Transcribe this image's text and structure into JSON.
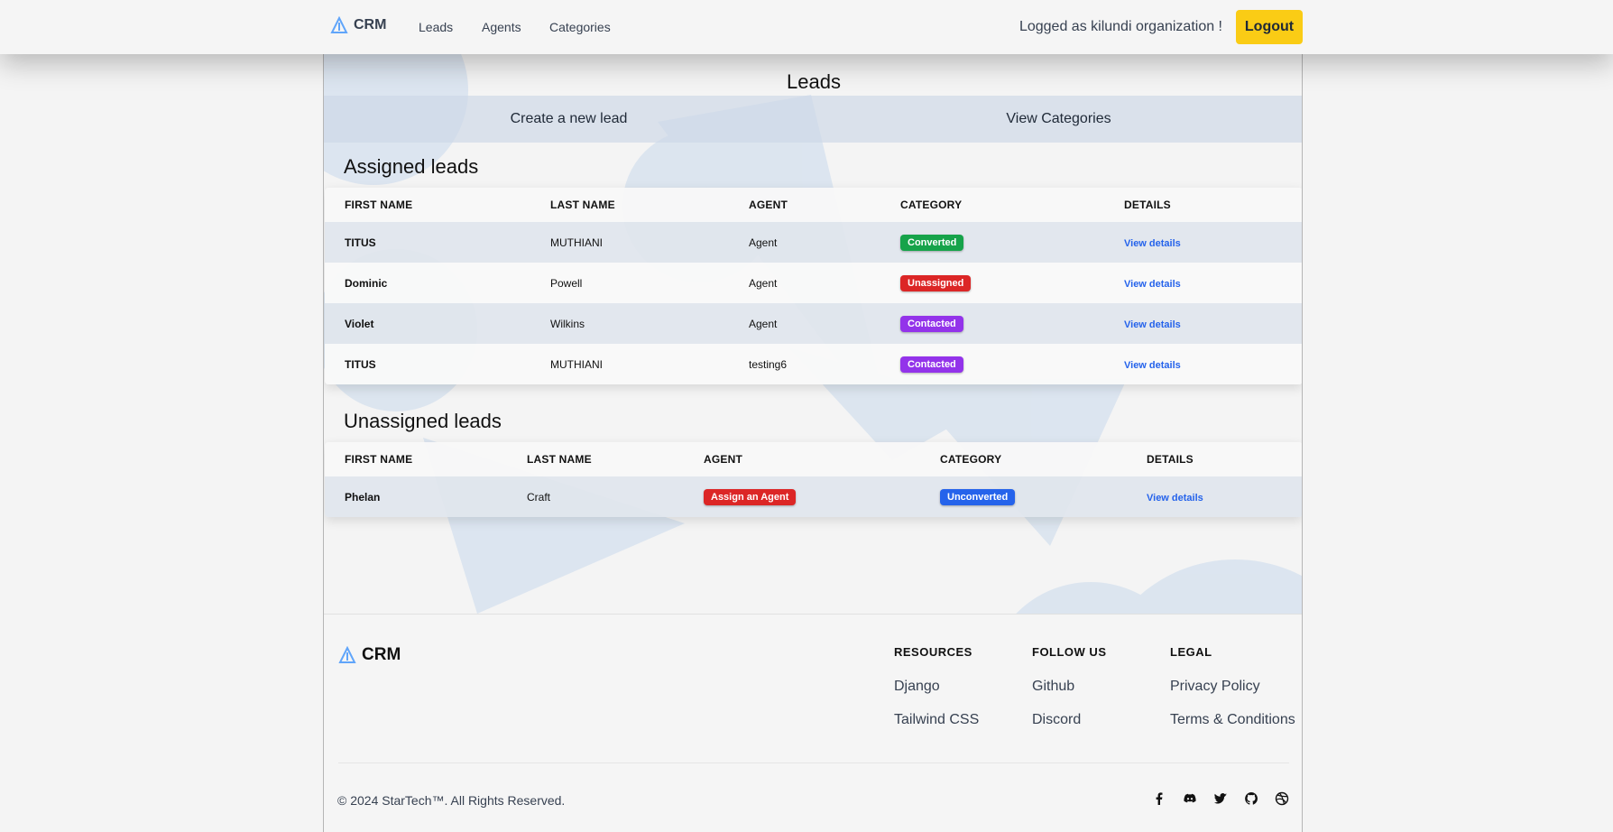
{
  "nav": {
    "brand": "CRM",
    "links": [
      "Leads",
      "Agents",
      "Categories"
    ],
    "user_text": "Logged as kilundi organization !",
    "logout_label": "Logout"
  },
  "main": {
    "title": "Leads",
    "actions": [
      "Create a new lead",
      "View Categories"
    ]
  },
  "assigned": {
    "title": "Assigned leads",
    "headers": [
      "FIRST NAME",
      "LAST NAME",
      "AGENT",
      "CATEGORY",
      "DETAILS"
    ],
    "rows": [
      {
        "first": "TITUS",
        "last": "MUTHIANI",
        "agent": "Agent",
        "category": "Converted",
        "details": "View details"
      },
      {
        "first": "Dominic",
        "last": "Powell",
        "agent": "Agent",
        "category": "Unassigned",
        "details": "View details"
      },
      {
        "first": "Violet",
        "last": "Wilkins",
        "agent": "Agent",
        "category": "Contacted",
        "details": "View details"
      },
      {
        "first": "TITUS",
        "last": "MUTHIANI",
        "agent": "testing6",
        "category": "Contacted",
        "details": "View details"
      }
    ]
  },
  "unassigned": {
    "title": "Unassigned leads",
    "headers": [
      "FIRST NAME",
      "LAST NAME",
      "AGENT",
      "CATEGORY",
      "DETAILS"
    ],
    "rows": [
      {
        "first": "Phelan",
        "last": "Craft",
        "agent": "Assign an Agent",
        "category": "Unconverted",
        "details": "View details"
      }
    ]
  },
  "category_colors": {
    "Converted": "#16a34a",
    "Unassigned": "#dc2626",
    "Contacted": "#9333ea",
    "Unconverted": "#2563eb",
    "Assign an Agent": "#dc2626"
  },
  "footer": {
    "brand": "CRM",
    "columns": [
      {
        "title": "RESOURCES",
        "links": [
          "Django",
          "Tailwind CSS"
        ]
      },
      {
        "title": "FOLLOW US",
        "links": [
          "Github",
          "Discord"
        ]
      },
      {
        "title": "LEGAL",
        "links": [
          "Privacy Policy",
          "Terms & Conditions"
        ]
      }
    ],
    "copyright": "© 2024 StarTech™. All Rights Reserved.",
    "socials": [
      "facebook-icon",
      "discord-icon",
      "twitter-icon",
      "github-icon",
      "dribbble-icon"
    ]
  }
}
